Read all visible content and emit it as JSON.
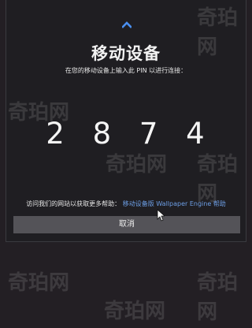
{
  "dialog": {
    "title": "移动设备",
    "subtitle": "在您的移动设备上输入此 PIN 以进行连接：",
    "pin": "2 8 7 4",
    "help_prefix": "访问我们的网站以获取更多帮助：",
    "help_link": "移动设备版 Wallpaper Engine 帮助",
    "cancel_label": "取消"
  },
  "watermark": {
    "text": "奇珀网"
  },
  "colors": {
    "accent": "#4a8ff0",
    "link": "#6d9fe6",
    "button": "#545358",
    "background": "#231f24"
  },
  "icons": {
    "top": "chevron-up-icon",
    "pointer": "mouse-cursor-icon"
  }
}
